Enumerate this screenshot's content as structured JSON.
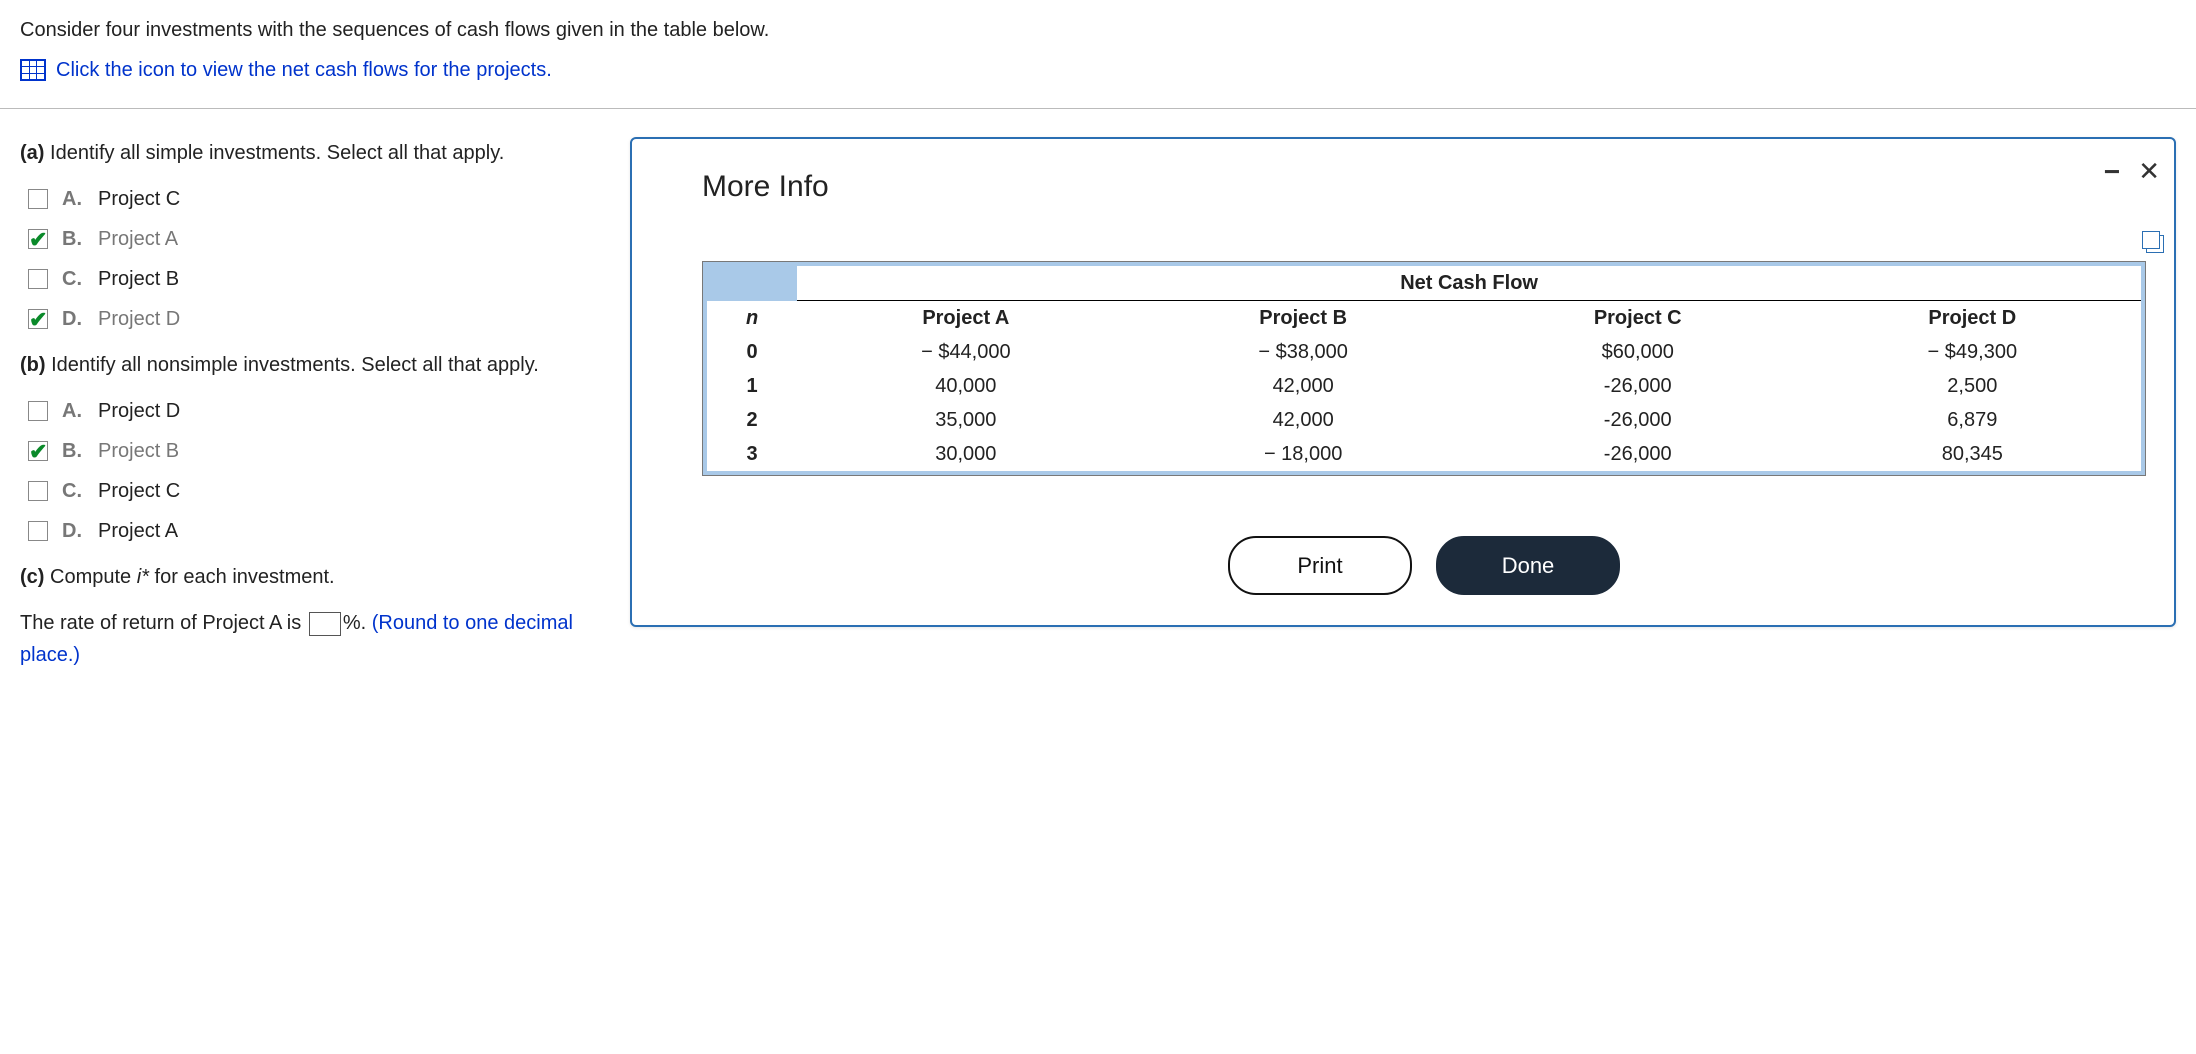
{
  "intro": "Consider four investments with the sequences of cash flows given in the table below.",
  "link_text": "Click the icon to view the net cash flows for the projects.",
  "parts": {
    "a": {
      "label": "(a)",
      "prompt": "Identify all simple investments. Select all that apply.",
      "options": [
        {
          "letter": "A.",
          "label": "Project C",
          "checked": false
        },
        {
          "letter": "B.",
          "label": "Project A",
          "checked": true
        },
        {
          "letter": "C.",
          "label": "Project B",
          "checked": false
        },
        {
          "letter": "D.",
          "label": "Project D",
          "checked": true
        }
      ]
    },
    "b": {
      "label": "(b)",
      "prompt": "Identify all nonsimple investments. Select all that apply.",
      "options": [
        {
          "letter": "A.",
          "label": "Project D",
          "checked": false
        },
        {
          "letter": "B.",
          "label": "Project B",
          "checked": true
        },
        {
          "letter": "C.",
          "label": "Project C",
          "checked": false
        },
        {
          "letter": "D.",
          "label": "Project A",
          "checked": false
        }
      ]
    },
    "c": {
      "label": "(c)",
      "prompt_before_i": "Compute ",
      "i_star": "i*",
      "prompt_after_i": " for each investment.",
      "answer_pre": "The rate of return of Project A is ",
      "answer_post": "%. ",
      "round_note": "(Round to one decimal place.)"
    }
  },
  "dialog": {
    "title": "More Info",
    "super_header": "Net Cash Flow",
    "columns": [
      "n",
      "Project A",
      "Project B",
      "Project C",
      "Project D"
    ],
    "rows": [
      [
        "0",
        "− $44,000",
        "− $38,000",
        "$60,000",
        "− $49,300"
      ],
      [
        "1",
        "40,000",
        "42,000",
        "-26,000",
        "2,500"
      ],
      [
        "2",
        "35,000",
        "42,000",
        "-26,000",
        "6,879"
      ],
      [
        "3",
        "30,000",
        "− 18,000",
        "-26,000",
        "80,345"
      ]
    ],
    "print": "Print",
    "done": "Done"
  }
}
